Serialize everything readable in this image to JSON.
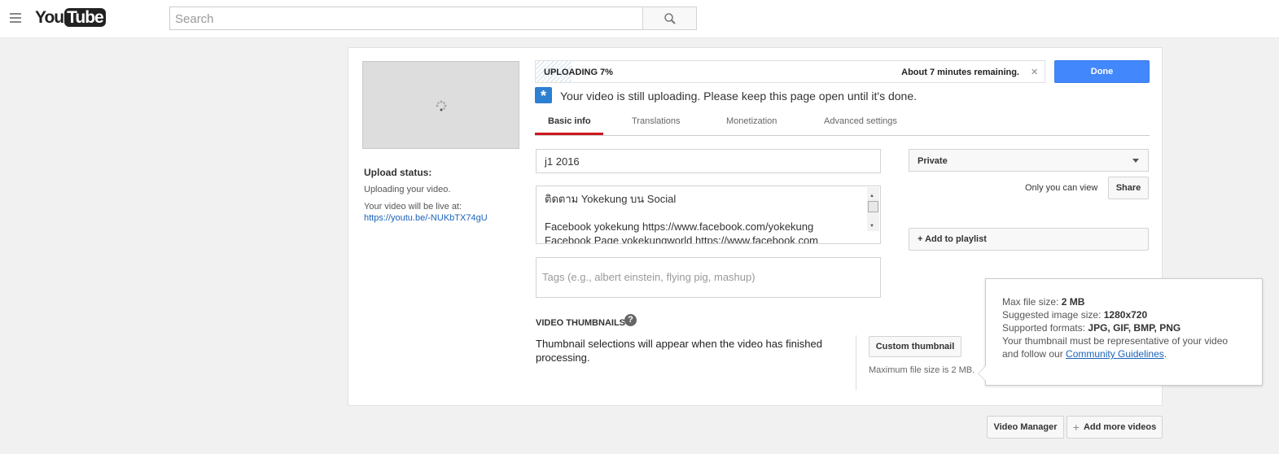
{
  "header": {
    "logo": "YouTube",
    "logo_a": "You",
    "logo_b": "Tube",
    "search_placeholder": "Search"
  },
  "sidebar": {
    "upload_status_title": "Upload status:",
    "upload_status_text": "Uploading your video.",
    "live_at_label": "Your video will be live at:",
    "video_url": "https://youtu.be/-NUKbTX74gU"
  },
  "upload": {
    "label": "UPLOADING 7%",
    "progress_percent": 7,
    "remaining": "About 7 minutes remaining.",
    "done_label": "Done",
    "notice": "Your video is still uploading. Please keep this page open until it's done."
  },
  "tabs": [
    {
      "label": "Basic info",
      "active": true
    },
    {
      "label": "Translations"
    },
    {
      "label": "Monetization"
    },
    {
      "label": "Advanced settings"
    }
  ],
  "form": {
    "title": "j1 2016",
    "description_lines": [
      "ติดตาม Yokekung บน Social",
      "",
      "Facebook yokekung https://www.facebook.com/yokekung",
      "Facebook Page yokekungworld https://www.facebook.com"
    ],
    "tags_placeholder": "Tags (e.g., albert einstein, flying pig, mashup)"
  },
  "privacy": {
    "selected": "Private",
    "note": "Only you can view",
    "share_label": "Share",
    "playlist_label": "+ Add to playlist"
  },
  "thumbnails": {
    "heading": "VIDEO THUMBNAILS",
    "message": "Thumbnail selections will appear when the video has finished processing.",
    "custom_label": "Custom thumbnail",
    "max_size": "Maximum file size is 2 MB."
  },
  "tooltip": {
    "l1_label": "Max file size: ",
    "l1_value": "2 MB",
    "l2_label": "Suggested image size: ",
    "l2_value": "1280x720",
    "l3_label": "Supported formats: ",
    "l3_value": "JPG, GIF, BMP, PNG",
    "l4": "Your thumbnail must be representative of your video",
    "l5_pre": "and follow our ",
    "l5_link": "Community Guidelines",
    "l5_post": "."
  },
  "footer": {
    "video_manager": "Video Manager",
    "add_more": "Add more videos"
  },
  "colors": {
    "accent": "#4387fd",
    "tab_underline": "#cc181e",
    "link": "#1c62b9"
  }
}
